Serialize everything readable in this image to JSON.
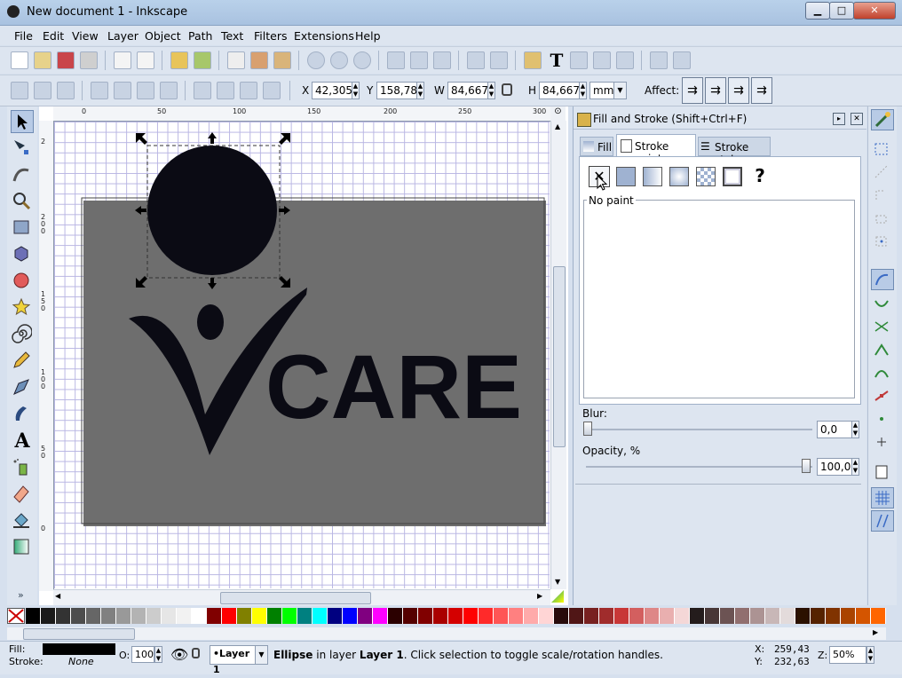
{
  "window": {
    "title": "New document 1 - Inkscape",
    "minimize": "▁",
    "maximize": "□",
    "close": "✕"
  },
  "menu": [
    "File",
    "Edit",
    "View",
    "Layer",
    "Object",
    "Path",
    "Text",
    "Filters",
    "Extensions",
    "Help"
  ],
  "ctrl": {
    "x_label": "X",
    "x_value": "42,305",
    "y_label": "Y",
    "y_value": "158,787",
    "w_label": "W",
    "w_value": "84,667",
    "h_label": "H",
    "h_value": "84,667",
    "unit": "mm",
    "affect_label": "Affect:"
  },
  "ruler_h": [
    "0",
    "50",
    "100",
    "150",
    "200",
    "250",
    "300"
  ],
  "ruler_v": [
    "2",
    "2\n0\n0",
    "1\n5\n0",
    "1\n0\n0",
    "5\n0",
    "0"
  ],
  "canvas": {
    "logo_text": "CARE"
  },
  "dock": {
    "title": "Fill and Stroke (Shift+Ctrl+F)",
    "tabs": [
      "Fill",
      "Stroke paint",
      "Stroke style"
    ],
    "paint_modes": [
      "no-paint",
      "flat-color",
      "linear-gradient",
      "radial-gradient",
      "pattern",
      "swatch",
      "unset"
    ],
    "unset_glyph": "?",
    "no_paint_label": "No paint",
    "blur_label": "Blur:",
    "blur_value": "0,0",
    "opacity_label": "Opacity, %",
    "opacity_value": "100,0"
  },
  "palette": [
    "#000000",
    "#1a1a1a",
    "#333333",
    "#4d4d4d",
    "#666666",
    "#808080",
    "#999999",
    "#b3b3b3",
    "#cccccc",
    "#e6e6e6",
    "#f2f2f2",
    "#ffffff",
    "#800000",
    "#ff0000",
    "#808000",
    "#ffff00",
    "#008000",
    "#00ff00",
    "#008080",
    "#00ffff",
    "#000080",
    "#0000ff",
    "#800080",
    "#ff00ff",
    "#2b0000",
    "#550000",
    "#800000",
    "#aa0000",
    "#d40000",
    "#ff0000",
    "#ff2a2a",
    "#ff5555",
    "#ff8080",
    "#ffaaaa",
    "#ffd5d5",
    "#280b0b",
    "#501616",
    "#782121",
    "#a02c2c",
    "#c83737",
    "#d35f5f",
    "#de8787",
    "#e9afaf",
    "#f4d7d7",
    "#241c1c",
    "#483737",
    "#6c5353",
    "#916f6f",
    "#ac9393",
    "#c8b7b7",
    "#e3dbdb",
    "#2b1100",
    "#552200",
    "#803300",
    "#aa4400",
    "#d45500",
    "#ff6600"
  ],
  "status": {
    "fill_label": "Fill:",
    "stroke_label": "Stroke:",
    "stroke_value": "None",
    "opacity_label": "O:",
    "opacity_value": "100",
    "layer": "•Layer 1",
    "message_bold1": "Ellipse",
    "message_mid": " in layer ",
    "message_bold2": "Layer 1",
    "message_rest": ". Click selection to toggle scale/rotation handles.",
    "x_label": "X:",
    "x_value": "259,43",
    "y_label": "Y:",
    "y_value": "232,63",
    "zoom_label": "Z:",
    "zoom_value": "50%"
  },
  "colors": {
    "accent": "#316ac5",
    "object": "#0b0b14",
    "grid": "#b9b6e3"
  }
}
